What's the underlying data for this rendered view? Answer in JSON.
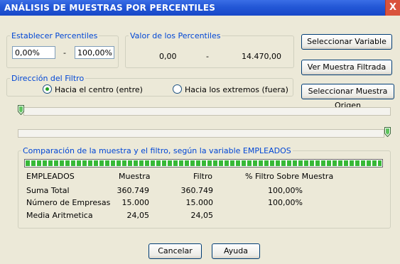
{
  "window": {
    "title": "ANÁLISIS DE MUESTRAS POR PERCENTILES",
    "close_label": "X"
  },
  "percentiles": {
    "group_label": "Establecer Percentiles",
    "low": "0,00%",
    "separator": "-",
    "high": "100,00%"
  },
  "values": {
    "group_label": "Valor de los Percentiles",
    "low": "0,00",
    "separator": "-",
    "high": "14.470,00"
  },
  "buttons": {
    "select_variable": "Seleccionar Variable",
    "view_filtered": "Ver Muestra Filtrada",
    "select_origin": "Seleccionar Muestra Origen",
    "cancel": "Cancelar",
    "help": "Ayuda"
  },
  "direction": {
    "group_label": "Dirección del Filtro",
    "option_center": "Hacia el centro (entre)",
    "option_extremes": "Hacia los extremos (fuera)",
    "selected": "center"
  },
  "sliders": {
    "low_fraction": 0.0,
    "high_fraction": 1.0
  },
  "comparison": {
    "group_label": "Comparación de la muestra y el filtro, según la variable EMPLEADOS",
    "progress_fraction": 1.0,
    "headers": [
      "EMPLEADOS",
      "Muestra",
      "Filtro",
      "% Filtro Sobre Muestra"
    ],
    "rows": [
      [
        "Suma Total",
        "360.749",
        "360.749",
        "100,00%"
      ],
      [
        "Número de Empresas",
        "15.000",
        "15.000",
        "100,00%"
      ],
      [
        "Media Aritmetica",
        "24,05",
        "24,05",
        ""
      ]
    ]
  },
  "colors": {
    "title_bar": "#2357d6",
    "group_label": "#0046d5",
    "progress": "#37b837"
  }
}
